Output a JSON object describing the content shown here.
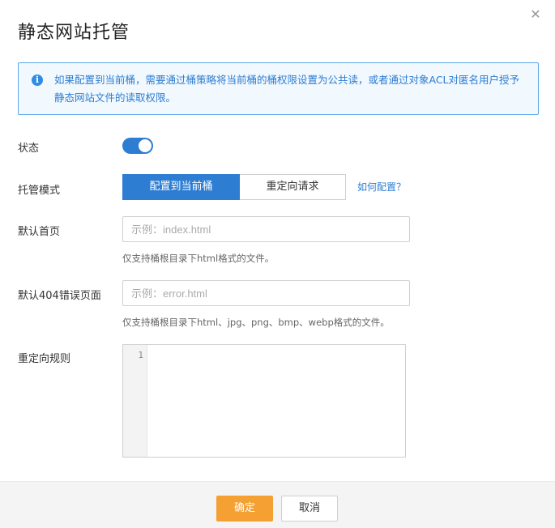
{
  "dialog": {
    "title": "静态网站托管",
    "close_glyph": "✕"
  },
  "notice": {
    "icon": "info-icon",
    "icon_glyph": "i",
    "text": "如果配置到当前桶，需要通过桶策略将当前桶的桶权限设置为公共读，或者通过对象ACL对匿名用户授予静态网站文件的读取权限。"
  },
  "form": {
    "status": {
      "label": "状态",
      "enabled": true
    },
    "hosting_mode": {
      "label": "托管模式",
      "options": [
        "配置到当前桶",
        "重定向请求"
      ],
      "selected": "配置到当前桶",
      "help_link": "如何配置？"
    },
    "default_index": {
      "label": "默认首页",
      "placeholder": "示例：index.html",
      "value": "",
      "hint": "仅支持桶根目录下html格式的文件。"
    },
    "default_404": {
      "label": "默认404错误页面",
      "placeholder": "示例：error.html",
      "value": "",
      "hint": "仅支持桶根目录下html、jpg、png、bmp、webp格式的文件。"
    },
    "redirect_rules": {
      "label": "重定向规则",
      "line_number": "1",
      "value": ""
    }
  },
  "footer": {
    "ok_label": "确定",
    "cancel_label": "取消"
  },
  "colors": {
    "primary": "#2d7dd2",
    "confirm": "#f5a033",
    "notice_bg": "#f1f8fe"
  }
}
